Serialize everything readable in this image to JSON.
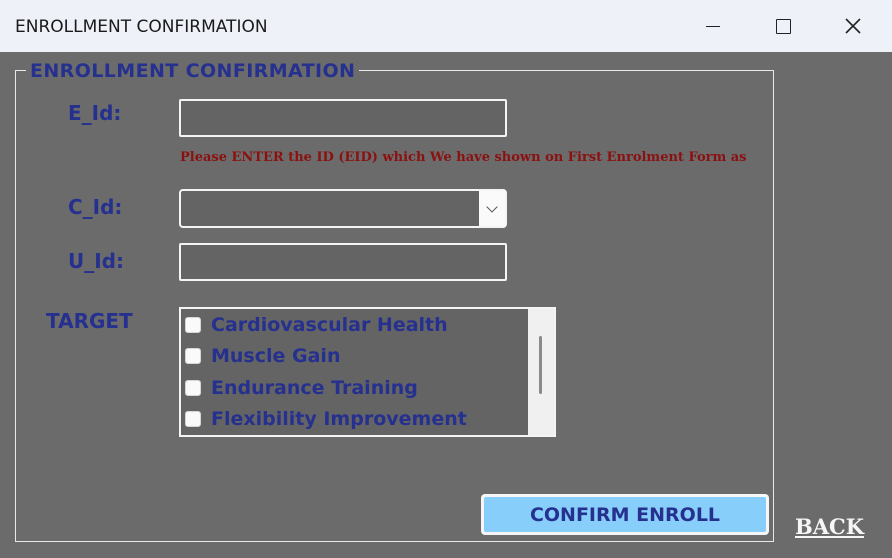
{
  "window": {
    "title": "ENROLLMENT CONFIRMATION",
    "controls": {
      "minimize": "minimize-icon",
      "maximize": "maximize-icon",
      "close": "close-icon"
    }
  },
  "form": {
    "group_title": "ENROLLMENT CONFIRMATION",
    "eid_label": "E_Id:",
    "eid_value": "",
    "hint": "Please ENTER the ID (EID) which We have shown on First Enrolment Form as",
    "cid_label": "C_Id:",
    "cid_value": "",
    "uid_label": "U_Id:",
    "uid_value": "",
    "target_label": "TARGET",
    "targets": [
      {
        "label": "Cardiovascular Health",
        "checked": false
      },
      {
        "label": "Muscle Gain",
        "checked": false
      },
      {
        "label": "Endurance Training",
        "checked": false
      },
      {
        "label": "Flexibility Improvement",
        "checked": false
      }
    ],
    "confirm_label": "CONFIRM ENROLL",
    "back_label": "BACK"
  },
  "colors": {
    "panel_bg": "#6b6b6b",
    "label_text": "#25308f",
    "hint_text": "#8b1010",
    "confirm_bg": "#87cefa"
  }
}
